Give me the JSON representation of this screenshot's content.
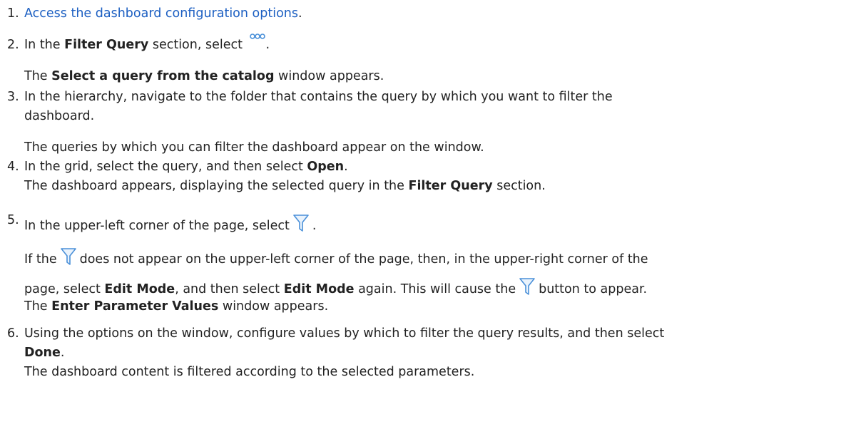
{
  "steps": [
    {
      "num": "1.",
      "link": "Access the dashboard configuration options",
      "after": "."
    },
    {
      "num": "2.",
      "pre": "In the ",
      "bold1": "Filter Query",
      "mid": " section, select ",
      "icon": "more-options-icon",
      "post": ".",
      "result_bold": "Select a query from the catalog",
      "result_pre": "The ",
      "result_post": " window appears."
    },
    {
      "num": "3.",
      "line1": "In the hierarchy, navigate to the folder that contains the query by which you want to filter the",
      "line2": "dashboard.",
      "result": "The queries by which you can filter the dashboard appear on the window."
    },
    {
      "num": "4.",
      "pre": "In the grid, select the query, and then select ",
      "bold1": "Open",
      "post": ".",
      "result_pre": "The dashboard appears, displaying the selected query in the ",
      "result_bold": "Filter Query",
      "result_post": " section."
    },
    {
      "num": "5.",
      "pre": "In the upper-left corner of the page, select",
      "icon": "filter-funnel-icon",
      "post": ".",
      "note1_pre": "If the",
      "note1_post": "does not appear on the upper-left corner of the page, then, in the upper-right corner of the",
      "note2_pre": "page, select ",
      "note2_bold1": "Edit Mode",
      "note2_mid": ", and then select ",
      "note2_bold2": "Edit Mode",
      "note2_mid2": " again. This will cause the",
      "note2_post": "button to appear.",
      "result_pre": "The ",
      "result_bold": "Enter Parameter Values",
      "result_post": " window appears."
    },
    {
      "num": "6.",
      "line1": "Using the options on the window, configure values by which to filter the query results, and then select",
      "bold1": "Done",
      "post": ".",
      "result": "The dashboard content is filtered according to the selected parameters."
    }
  ],
  "colors": {
    "link": "#1c5fc2",
    "icon": "#4a90d9",
    "text": "#222222"
  }
}
